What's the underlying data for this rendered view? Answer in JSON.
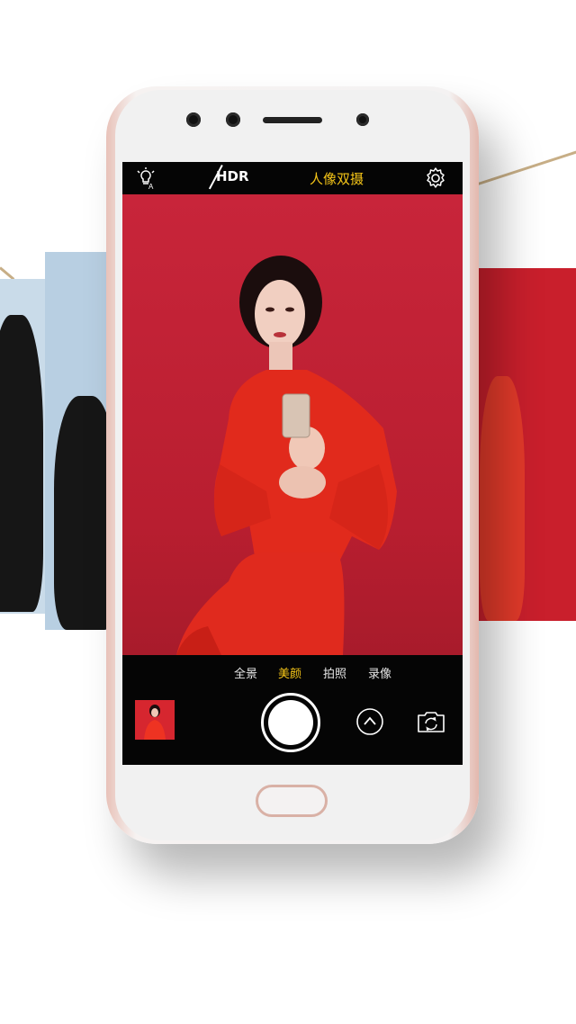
{
  "camera": {
    "top_bar": {
      "flash_icon": "auto-flash-icon",
      "hdr_label": "HDR",
      "mode_title": "人像双摄",
      "settings_icon": "gear-icon"
    },
    "modes": [
      {
        "label": "全景",
        "active": false
      },
      {
        "label": "美颜",
        "active": true
      },
      {
        "label": "拍照",
        "active": false
      },
      {
        "label": "录像",
        "active": false
      }
    ],
    "controls": {
      "gallery_thumbnail": "gallery-thumbnail",
      "shutter": "shutter-button",
      "expand_icon": "chevron-up-icon",
      "switch_camera_icon": "switch-camera-icon"
    }
  },
  "colors": {
    "accent": "#f5c518",
    "viewfinder_red": "#c8253a",
    "screen_black": "#050505",
    "phone_rose_gold": "#e8c2b9"
  }
}
